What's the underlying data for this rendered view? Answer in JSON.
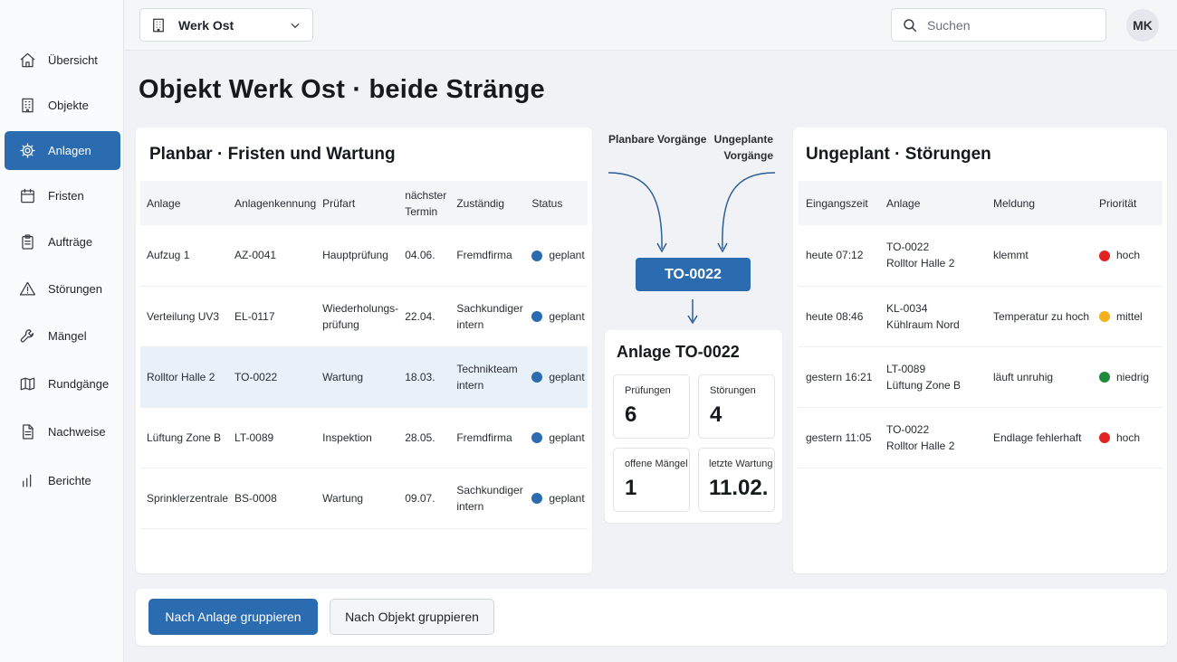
{
  "colors": {
    "accent": "#2b6cb0",
    "status_planned": "#2b6cb0",
    "priority_high": "#e02424",
    "priority_medium": "#f2b11b",
    "priority_low": "#1f8a3c"
  },
  "sidebar": {
    "items": [
      {
        "label": "Übersicht",
        "icon": "home-icon",
        "active": false
      },
      {
        "label": "Objekte",
        "icon": "building-icon",
        "active": false
      },
      {
        "label": "Anlagen",
        "icon": "gear-icon",
        "active": true
      },
      {
        "label": "Fristen",
        "icon": "calendar-icon",
        "active": false
      },
      {
        "label": "Aufträge",
        "icon": "clipboard-icon",
        "active": false
      },
      {
        "label": "Störungen",
        "icon": "warning-icon",
        "active": false
      },
      {
        "label": "Mängel",
        "icon": "wrench-icon",
        "active": false
      },
      {
        "label": "Rundgänge",
        "icon": "map-icon",
        "active": false
      },
      {
        "label": "Nachweise",
        "icon": "document-icon",
        "active": false
      },
      {
        "label": "Berichte",
        "icon": "bar-chart-icon",
        "active": false
      }
    ]
  },
  "topbar": {
    "site_selector": "Werk Ost",
    "search_placeholder": "Suchen",
    "user_initials": "MK"
  },
  "page": {
    "title": "Objekt Werk Ost · beide Stränge"
  },
  "planbar": {
    "title": "Planbar · Fristen und Wartung",
    "columns": [
      "Anlage",
      "Anlagenkennung",
      "Prüfart",
      "nächster Termin",
      "Zuständig",
      "Status"
    ],
    "rows": [
      {
        "anlage": "Aufzug 1",
        "kennung": "AZ-0041",
        "pruefart": "Hauptprüfung",
        "termin": "04.06.",
        "zustaendig": "Fremdfirma",
        "status": "geplant",
        "highlight": false
      },
      {
        "anlage": "Verteilung UV3",
        "kennung": "EL-0117",
        "pruefart": "Wiederholungs-prüfung",
        "termin": "22.04.",
        "zustaendig": "Sachkundiger intern",
        "status": "geplant",
        "highlight": false
      },
      {
        "anlage": "Rolltor Halle 2",
        "kennung": "TO-0022",
        "pruefart": "Wartung",
        "termin": "18.03.",
        "zustaendig": "Technikteam intern",
        "status": "geplant",
        "highlight": true
      },
      {
        "anlage": "Lüftung Zone B",
        "kennung": "LT-0089",
        "pruefart": "Inspektion",
        "termin": "28.05.",
        "zustaendig": "Fremdfirma",
        "status": "geplant",
        "highlight": false
      },
      {
        "anlage": "Sprinklerzentrale",
        "kennung": "BS-0008",
        "pruefart": "Wartung",
        "termin": "09.07.",
        "zustaendig": "Sachkundiger intern",
        "status": "geplant",
        "highlight": false
      }
    ]
  },
  "flow": {
    "planbar_label": "Planbare Vorgänge",
    "ungeplant_label": "Ungeplante Vorgänge",
    "focus_id": "TO-0022"
  },
  "anlage_card": {
    "title": "Anlage TO-0022",
    "metrics": [
      {
        "label": "Prüfungen",
        "value": "6"
      },
      {
        "label": "Störungen",
        "value": "4"
      },
      {
        "label": "offene Mängel",
        "value": "1"
      },
      {
        "label": "letzte Wartung",
        "value": "11.02."
      }
    ]
  },
  "ungeplant": {
    "title": "Ungeplant · Störungen",
    "columns": [
      "Eingangszeit",
      "Anlage",
      "Meldung",
      "Priorität"
    ],
    "rows": [
      {
        "zeit": "heute 07:12",
        "anlage_id": "TO-0022",
        "anlage_name": "Rolltor Halle 2",
        "meldung": "klemmt",
        "prioritaet": "hoch",
        "level": "high"
      },
      {
        "zeit": "heute 08:46",
        "anlage_id": "KL-0034",
        "anlage_name": "Kühlraum Nord",
        "meldung": "Temperatur zu hoch",
        "prioritaet": "mittel",
        "level": "medium"
      },
      {
        "zeit": "gestern 16:21",
        "anlage_id": "LT-0089",
        "anlage_name": "Lüftung Zone B",
        "meldung": "läuft unruhig",
        "prioritaet": "niedrig",
        "level": "low"
      },
      {
        "zeit": "gestern 11:05",
        "anlage_id": "TO-0022",
        "anlage_name": "Rolltor Halle 2",
        "meldung": "Endlage fehlerhaft",
        "prioritaet": "hoch",
        "level": "high"
      }
    ]
  },
  "actions": {
    "group_by_asset": "Nach Anlage gruppieren",
    "group_by_object": "Nach Objekt gruppieren"
  }
}
